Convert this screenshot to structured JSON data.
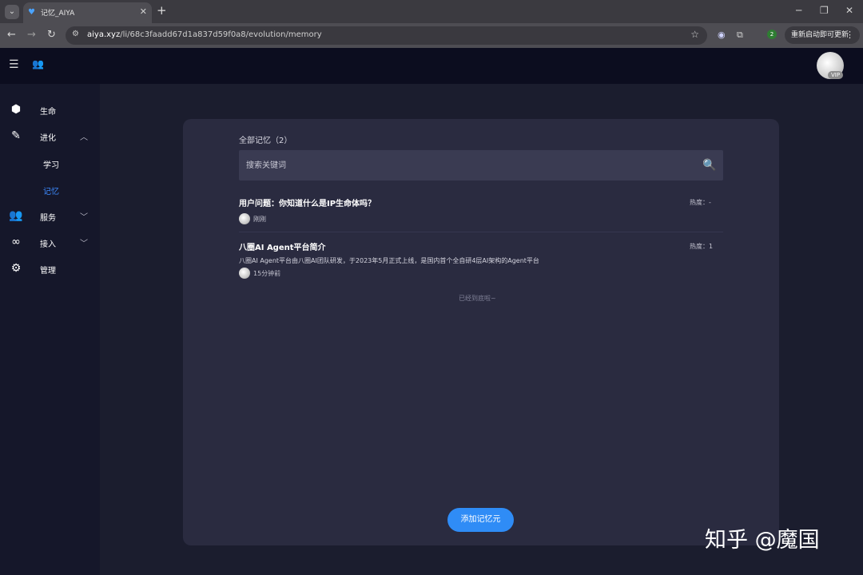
{
  "browser": {
    "tab_title": "记忆_AIYA",
    "url_host": "aiya.xyz",
    "url_path": "/li/68c3faadd67d1a837d59f0a8/evolution/memory",
    "profile_badge": "2",
    "restart_label": "重新启动即可更新"
  },
  "header": {
    "vip_label": "VIP"
  },
  "sidebar": {
    "items": [
      {
        "label": "生命",
        "icon": "life-icon"
      },
      {
        "label": "进化",
        "icon": "evolution-icon"
      },
      {
        "label": "服务",
        "icon": "service-icon"
      },
      {
        "label": "接入",
        "icon": "link-icon"
      },
      {
        "label": "管理",
        "icon": "gear-icon"
      }
    ],
    "sub_items": [
      {
        "label": "学习"
      },
      {
        "label": "记忆"
      }
    ]
  },
  "main": {
    "section_title": "全部记忆（2）",
    "search_placeholder": "搜索关键词",
    "memories": [
      {
        "title": "用户问题：你知道什么是IP生命体吗？",
        "heat": "热度：-",
        "desc": "",
        "time": "刚刚"
      },
      {
        "title": "八圈AI Agent平台简介",
        "heat": "热度：1",
        "desc": "八圈AI Agent平台由八圈AI团队研发，于2023年5月正式上线，是国内首个全自研4层AI架构的Agent平台",
        "time": "15分钟前"
      }
    ],
    "end_note": "已经到底啦~",
    "add_button": "添加记忆元"
  },
  "watermark": "知乎 @魔国",
  "colors": {
    "accent": "#2f8cf6",
    "active_nav": "#3d8bff",
    "card_bg": "#2a2b40",
    "sidebar_bg": "#15172a"
  }
}
